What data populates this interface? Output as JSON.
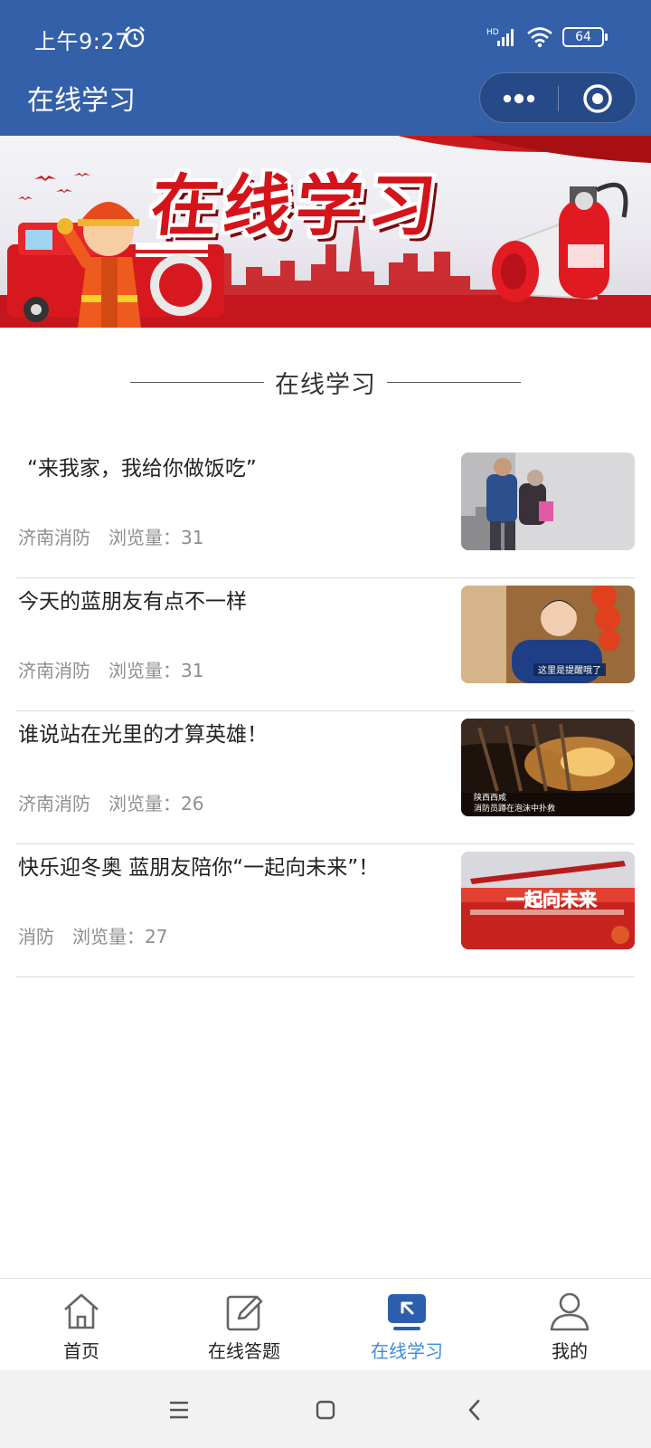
{
  "status": {
    "time": "上午9:27",
    "network": "HD",
    "battery": "64"
  },
  "header": {
    "title": "在线学习"
  },
  "banner": {
    "title": "在线学习"
  },
  "section": {
    "heading": "在线学习"
  },
  "articles": [
    {
      "title": "“来我家，我给你做饭吃”",
      "source": "济南消防",
      "views": "浏览量：31"
    },
    {
      "title": "今天的蓝朋友有点不一样",
      "source": "济南消防",
      "views": "浏览量：31"
    },
    {
      "title": "谁说站在光里的才算英雄！",
      "source": "济南消防",
      "views": "浏览量：26"
    },
    {
      "title": "快乐迎冬奥 蓝朋友陪你“一起向未来”！",
      "source": "消防",
      "views": "浏览量：27"
    }
  ],
  "thumbnails": {
    "item2_caption": "这里是提醒哦了",
    "item3_caption_line1": "陕西西咸",
    "item3_caption_line2": "消防员蹲在泡沫中扑救",
    "item4_caption": "一起向未来"
  },
  "tabs": [
    {
      "label": "首页",
      "icon": "home-icon",
      "active": false
    },
    {
      "label": "在线答题",
      "icon": "edit-icon",
      "active": false
    },
    {
      "label": "在线学习",
      "icon": "learn-icon",
      "active": true
    },
    {
      "label": "我的",
      "icon": "user-icon",
      "active": false
    }
  ],
  "colors": {
    "header": "#3360a8",
    "accent": "#3c8dd8",
    "banner_red": "#d4141a"
  }
}
